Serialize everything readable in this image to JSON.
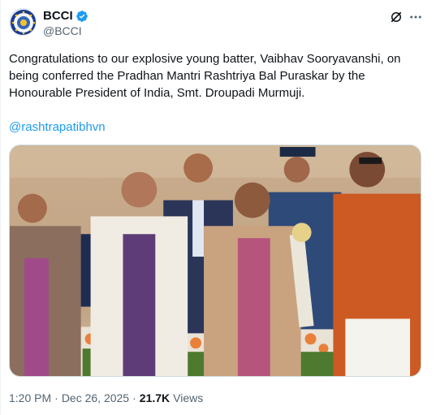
{
  "account": {
    "display_name": "BCCI",
    "handle": "@BCCI",
    "verified": true,
    "verified_color": "#1d9bf0"
  },
  "actions": {
    "grok_icon": "grok-icon",
    "more_icon": "more-dots-icon"
  },
  "tweet": {
    "text": "Congratulations to our explosive young batter, Vaibhav Sooryavanshi, on\nbeing conferred the Pradhan Mantri Rashtriya Bal Puraskar by the\nHonourable President of India, Smt. Droupadi Murmuji.",
    "mention": "@rashtrapatibhvn"
  },
  "media": {
    "description_icon": "award-ceremony-photo"
  },
  "meta": {
    "time": "1:20 PM",
    "separator": "·",
    "date": "Dec 26, 2025",
    "separator2": "·",
    "views_count": "21.7K",
    "views_label": "Views"
  },
  "colors": {
    "link": "#1d9bf0",
    "secondary_text": "#536471"
  }
}
